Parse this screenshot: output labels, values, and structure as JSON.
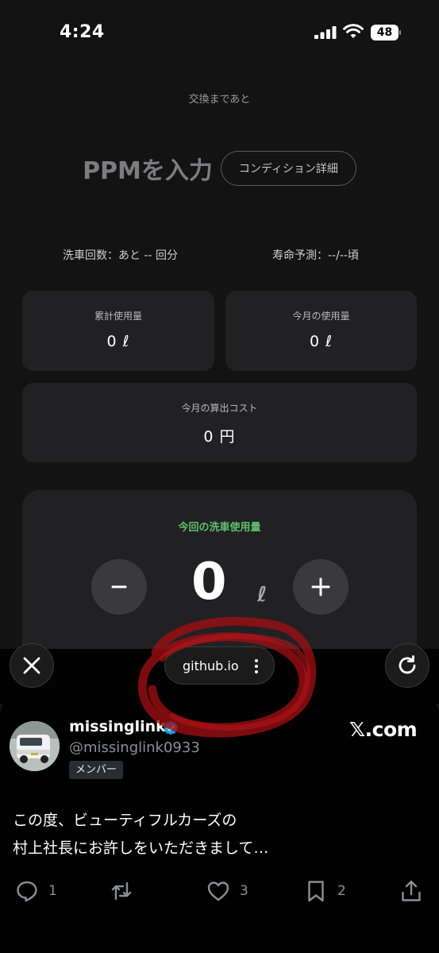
{
  "status_bar": {
    "time": "4:24",
    "battery": "48"
  },
  "app": {
    "exchange_label": "交換まであと",
    "ppm_title": "PPMを入力",
    "condition_button": "コンディション詳細",
    "wash_count": "洗車回数：あと -- 回分",
    "lifespan": "寿命予測：--/--頃",
    "total_usage": {
      "label": "累計使用量",
      "value": "0 ℓ"
    },
    "month_usage": {
      "label": "今月の使用量",
      "value": "0 ℓ"
    },
    "month_cost": {
      "label": "今月の算出コスト",
      "value": "0 円"
    },
    "current_usage": {
      "label": "今回の洗車使用量",
      "value": "0",
      "unit": "ℓ"
    }
  },
  "browser": {
    "url": "github.io"
  },
  "tweet": {
    "display_name": "missinglink",
    "handle": "@missinglink0933",
    "badge": "メンバー",
    "source": "𝕏.com",
    "text_lines": [
      "この度、ビューティフルカーズの",
      "村上社長にお許しをいただきまして…"
    ],
    "replies": "1",
    "retweets": "",
    "likes": "3",
    "bookmarks": "2"
  },
  "colors": {
    "accent_green": "#5ec26a",
    "annotation_red": "#c0191b",
    "verified_blue": "#1d9bf0"
  }
}
